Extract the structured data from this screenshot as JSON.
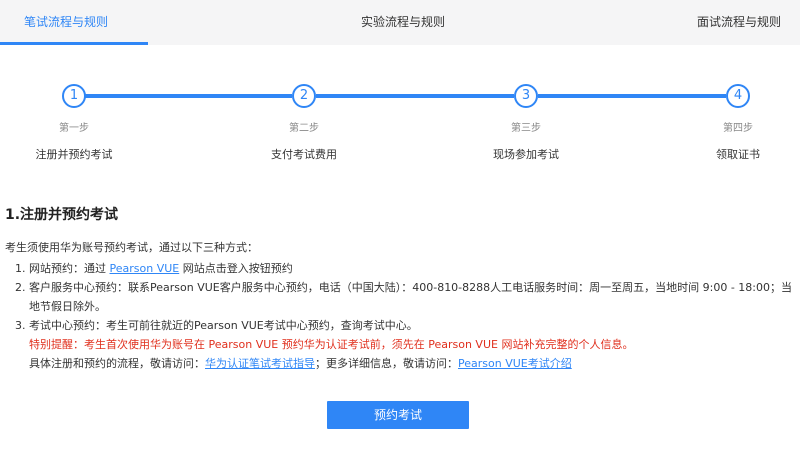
{
  "tabs": [
    {
      "label": "笔试流程与规则",
      "active": true
    },
    {
      "label": "实验流程与规则",
      "active": false
    },
    {
      "label": "面试流程与规则",
      "active": false
    }
  ],
  "steps": [
    {
      "number": "1",
      "sub": "第一步",
      "label": "注册并预约考试"
    },
    {
      "number": "2",
      "sub": "第二步",
      "label": "支付考试费用"
    },
    {
      "number": "3",
      "sub": "第三步",
      "label": "现场参加考试"
    },
    {
      "number": "4",
      "sub": "第四步",
      "label": "领取证书"
    }
  ],
  "content": {
    "title": "1.注册并预约考试",
    "intro": "考生须使用华为账号预约考试，通过以下三种方式：",
    "item1_prefix": "网站预约：通过 ",
    "item1_link": "Pearson VUE",
    "item1_suffix": " 网站点击登入按钮预约",
    "item2_text": "客户服务中心预约：联系Pearson VUE客户服务中心预约，电话（中国大陆）：400-810-8288人工电话服务时间：周一至周五，当地时间 9:00 - 18:00；当地节假日除外。",
    "item3_text": "考试中心预约：考生可前往就近的Pearson VUE考试中心预约，查询考试中心。",
    "notice": "特别提醒：考生首次使用华为账号在 Pearson VUE 预约华为认证考试前，须先在 Pearson VUE 网站补充完整的个人信息。",
    "more_prefix": "具体注册和预约的流程，敬请访问：",
    "more_link1": "华为认证笔试考试指导",
    "more_middle": "；更多详细信息，敬请访问：",
    "more_link2": "Pearson VUE考试介绍"
  },
  "button": {
    "label": "预约考试"
  },
  "colors": {
    "accent": "#2f86f6",
    "notice": "#e0301e"
  }
}
